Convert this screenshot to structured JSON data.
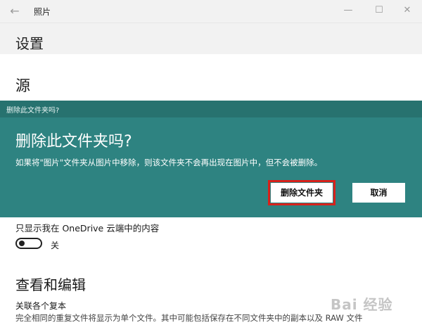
{
  "window": {
    "app_title": "照片",
    "back_icon": "back-arrow-icon",
    "minimize_icon": "minimize-icon",
    "maximize_icon": "maximize-icon",
    "close_icon": "close-icon"
  },
  "settings": {
    "title": "设置",
    "source_section": "源"
  },
  "dialog": {
    "bar_title": "删除此文件夹吗?",
    "heading": "删除此文件夹吗?",
    "message": "如果将\"图片\"文件夹从图片中移除，则该文件夹不会再出现在图片中，但不会被删除。",
    "delete_button": "删除文件夹",
    "cancel_button": "取消",
    "accent_color": "#2e8381",
    "highlight_color": "#d9211b"
  },
  "onedrive": {
    "label": "只显示我在 OneDrive 云端中的内容",
    "toggle_state": "关"
  },
  "view_edit": {
    "title": "查看和编辑",
    "linked_duplicates_label": "关联各个复本",
    "linked_duplicates_desc": "完全相同的重复文件将显示为单个文件。其中可能包括保存在不同文件夹中的副本以及 RAW 文件"
  },
  "watermark": "Bai 经验"
}
